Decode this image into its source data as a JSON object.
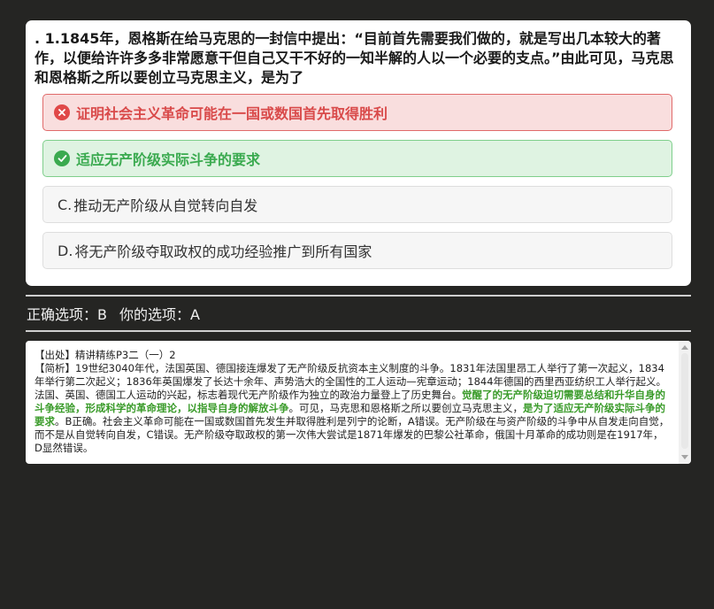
{
  "question": {
    "text": ". 1.1845年，恩格斯在给马克思的一封信中提出：“目前首先需要我们做的，就是写出几本较大的著作，以便给许许多多非常愿意干但自己又干不好的一知半解的人以一个必要的支点。”由此可见，马克思和恩格斯之所以要创立马克思主义，是为了"
  },
  "options": [
    {
      "prefix": "",
      "text": "证明社会主义革命可能在一国或数国首先取得胜利",
      "state": "wrong",
      "icon": "x-circle-icon"
    },
    {
      "prefix": "",
      "text": "适应无产阶级实际斗争的要求",
      "state": "correct",
      "icon": "check-circle-icon"
    },
    {
      "prefix": "C.",
      "text": "推动无产阶级从自觉转向自发",
      "state": "neutral"
    },
    {
      "prefix": "D.",
      "text": "将无产阶级夺取政权的成功经验推广到所有国家",
      "state": "neutral"
    }
  ],
  "answer": {
    "correct_label": "正确选项：",
    "correct_value": "B",
    "yours_label": "你的选项：",
    "yours_value": "A"
  },
  "analysis": {
    "source": "【出处】精讲精练P3二（一）2",
    "p1": "【简析】19世纪3040年代，法国英国、德国接连爆发了无产阶级反抗资本主义制度的斗争。1831年法国里昂工人举行了第一次起义，1834年举行第二次起义；1836年英国爆发了长达十余年、声势浩大的全国性的工人运动—宪章运动；1844年德国的西里西亚纺织工人举行起义。法国、英国、德国工人运动的兴起，标志着现代无产阶级作为独立的政治力量登上了历史舞台。",
    "hl1": "觉醒了的无产阶级迫切需要总结和升华自身的斗争经验，形成科学的革命理论，以指导自身的解放斗争",
    "p2": "。可见，马克思和恩格斯之所以要创立马克思主义，",
    "hl2": "是为了适应无产阶级实际斗争的要求",
    "p3": "。B正确。社会主义革命可能在一国或数国首先发生并取得胜利是列宁的论断，A错误。无产阶级在与资产阶级的斗争中从自发走向自觉，而不是从自觉转向自发，C错误。无产阶级夺取政权的第一次伟大尝试是1871年爆发的巴黎公社革命，俄国十月革命的成功则是在1917年，D显然错误。"
  },
  "colors": {
    "background": "#252523",
    "wrong": "#d94a4a",
    "correct": "#3aaa4f",
    "highlight": "#3a9b2a"
  }
}
